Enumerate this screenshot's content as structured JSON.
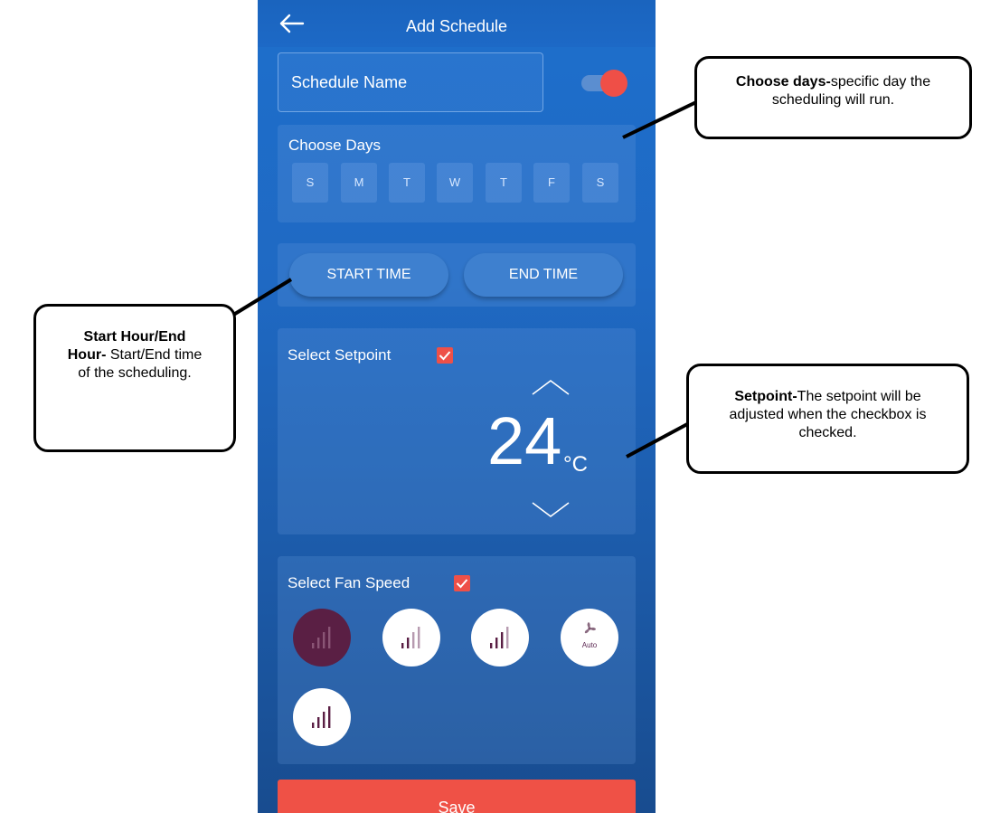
{
  "header": {
    "title": "Add Schedule"
  },
  "schedule_name": {
    "label": "Schedule Name",
    "toggle_on": true
  },
  "days": {
    "label": "Choose Days",
    "items": [
      "S",
      "M",
      "T",
      "W",
      "T",
      "F",
      "S"
    ]
  },
  "time": {
    "start_label": "START TIME",
    "end_label": "END TIME"
  },
  "setpoint": {
    "label": "Select Setpoint",
    "checked": true,
    "value": "24",
    "unit": "°C"
  },
  "fan": {
    "label": "Select Fan Speed",
    "checked": true,
    "auto_label": "Auto",
    "selected_index": 0
  },
  "save_label": "Save",
  "callouts": {
    "days": {
      "bold": "Choose days-",
      "text": "specific day the scheduling will run."
    },
    "time": {
      "bold": "Start Hour/End Hour-",
      "text": " Start/End time of the scheduling."
    },
    "setpoint": {
      "bold": "Setpoint-",
      "text": "The setpoint will be adjusted when the checkbox is checked."
    }
  },
  "colors": {
    "accent": "#ef5146",
    "phone_bg": "#1e6fcc",
    "fan_selected": "#5a1f44"
  }
}
